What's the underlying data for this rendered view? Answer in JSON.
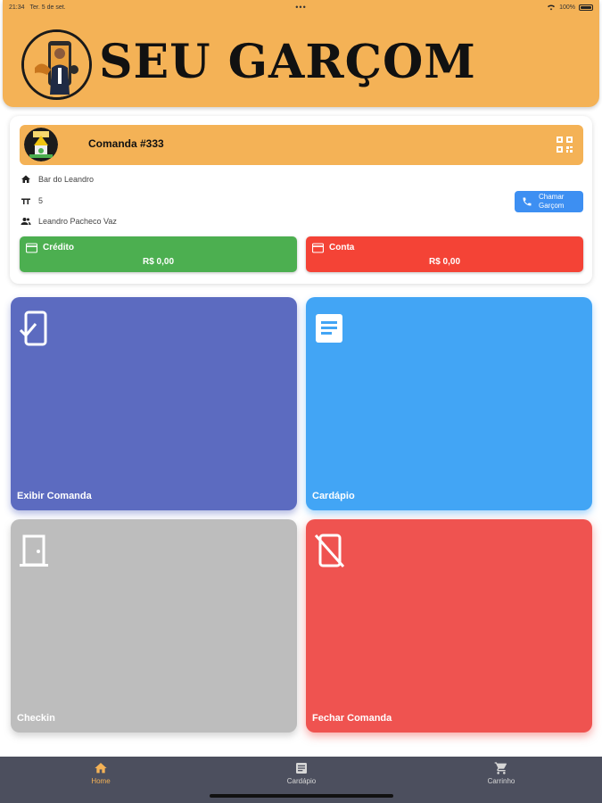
{
  "status_bar": {
    "time": "21:34",
    "date": "Ter. 5 de set.",
    "dots": "•••",
    "battery": "100%"
  },
  "header": {
    "brand": "SEU GARÇOM"
  },
  "card": {
    "comanda_title": "Comanda #333",
    "establishment": "Bar do Leandro",
    "table": "5",
    "customer": "Leandro Pacheco Vaz",
    "call_button_line1": "Chamar",
    "call_button_line2": "Garçom",
    "credit": {
      "label": "Crédito",
      "value": "R$ 0,00"
    },
    "account": {
      "label": "Conta",
      "value": "R$ 0,00"
    }
  },
  "tiles": [
    {
      "label": "Exibir Comanda",
      "icon": "phone-check-icon",
      "color": "#5c6bc0"
    },
    {
      "label": "Cardápio",
      "icon": "document-icon",
      "color": "#42a5f5"
    },
    {
      "label": "Checkin",
      "icon": "door-icon",
      "color": "#bdbdbd"
    },
    {
      "label": "Fechar Comanda",
      "icon": "phone-off-icon",
      "color": "#ef5350"
    }
  ],
  "nav": [
    {
      "label": "Home",
      "icon": "home-icon",
      "active": true
    },
    {
      "label": "Cardápio",
      "icon": "menu-icon",
      "active": false
    },
    {
      "label": "Carrinho",
      "icon": "cart-icon",
      "active": false
    }
  ],
  "colors": {
    "brand": "#f4b256",
    "nav_bg": "#4c4f5e",
    "accent_blue": "#3d8ff2"
  }
}
